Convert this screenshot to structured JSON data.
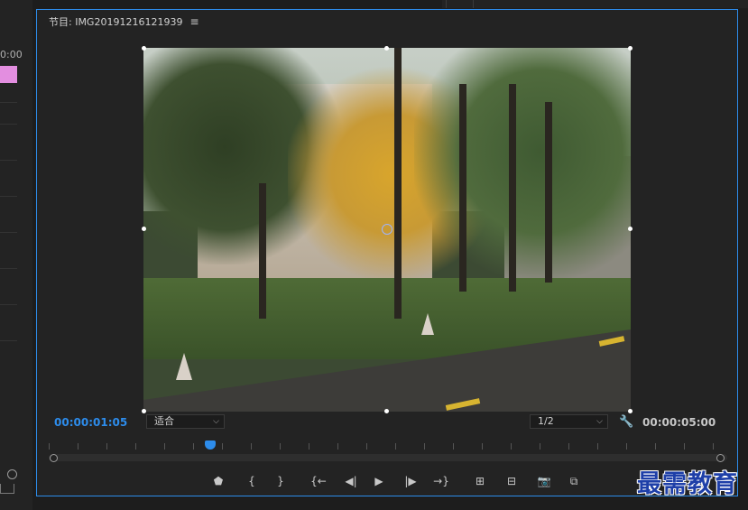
{
  "left_panel": {
    "timecode_fragment": "0:00"
  },
  "monitor": {
    "tab_label": "节目: IMG20191216121939",
    "menu_glyph": "≡",
    "current_timecode": "00:00:01:05",
    "duration_timecode": "00:00:05:00",
    "zoom_select": {
      "value": "适合"
    },
    "resolution_select": {
      "value": "1/2"
    },
    "settings_icon": "wrench-icon"
  },
  "controls": [
    {
      "name": "add-marker-button",
      "icon": "marker-icon",
      "glyph": "⬟"
    },
    {
      "name": "mark-in-button",
      "icon": "mark-in-icon",
      "glyph": "{"
    },
    {
      "name": "mark-out-button",
      "icon": "mark-out-icon",
      "glyph": "}"
    },
    {
      "name": "go-to-in-button",
      "icon": "go-to-in-icon",
      "glyph": "{←"
    },
    {
      "name": "step-back-button",
      "icon": "step-back-icon",
      "glyph": "◀|"
    },
    {
      "name": "play-button",
      "icon": "play-icon",
      "glyph": "▶"
    },
    {
      "name": "step-forward-button",
      "icon": "step-forward-icon",
      "glyph": "|▶"
    },
    {
      "name": "go-to-out-button",
      "icon": "go-to-out-icon",
      "glyph": "→}"
    },
    {
      "name": "lift-button",
      "icon": "lift-icon",
      "glyph": "⊞"
    },
    {
      "name": "extract-button",
      "icon": "extract-icon",
      "glyph": "⊟"
    },
    {
      "name": "export-frame-button",
      "icon": "camera-icon",
      "glyph": "📷"
    },
    {
      "name": "comparison-view-button",
      "icon": "comparison-icon",
      "glyph": "⧉"
    }
  ],
  "watermark": {
    "text": "最需教育"
  },
  "colors": {
    "accent": "#2d8ceb",
    "panel": "#232323",
    "pink_clip": "#e38ee0",
    "watermark": "#1e3fa8"
  }
}
